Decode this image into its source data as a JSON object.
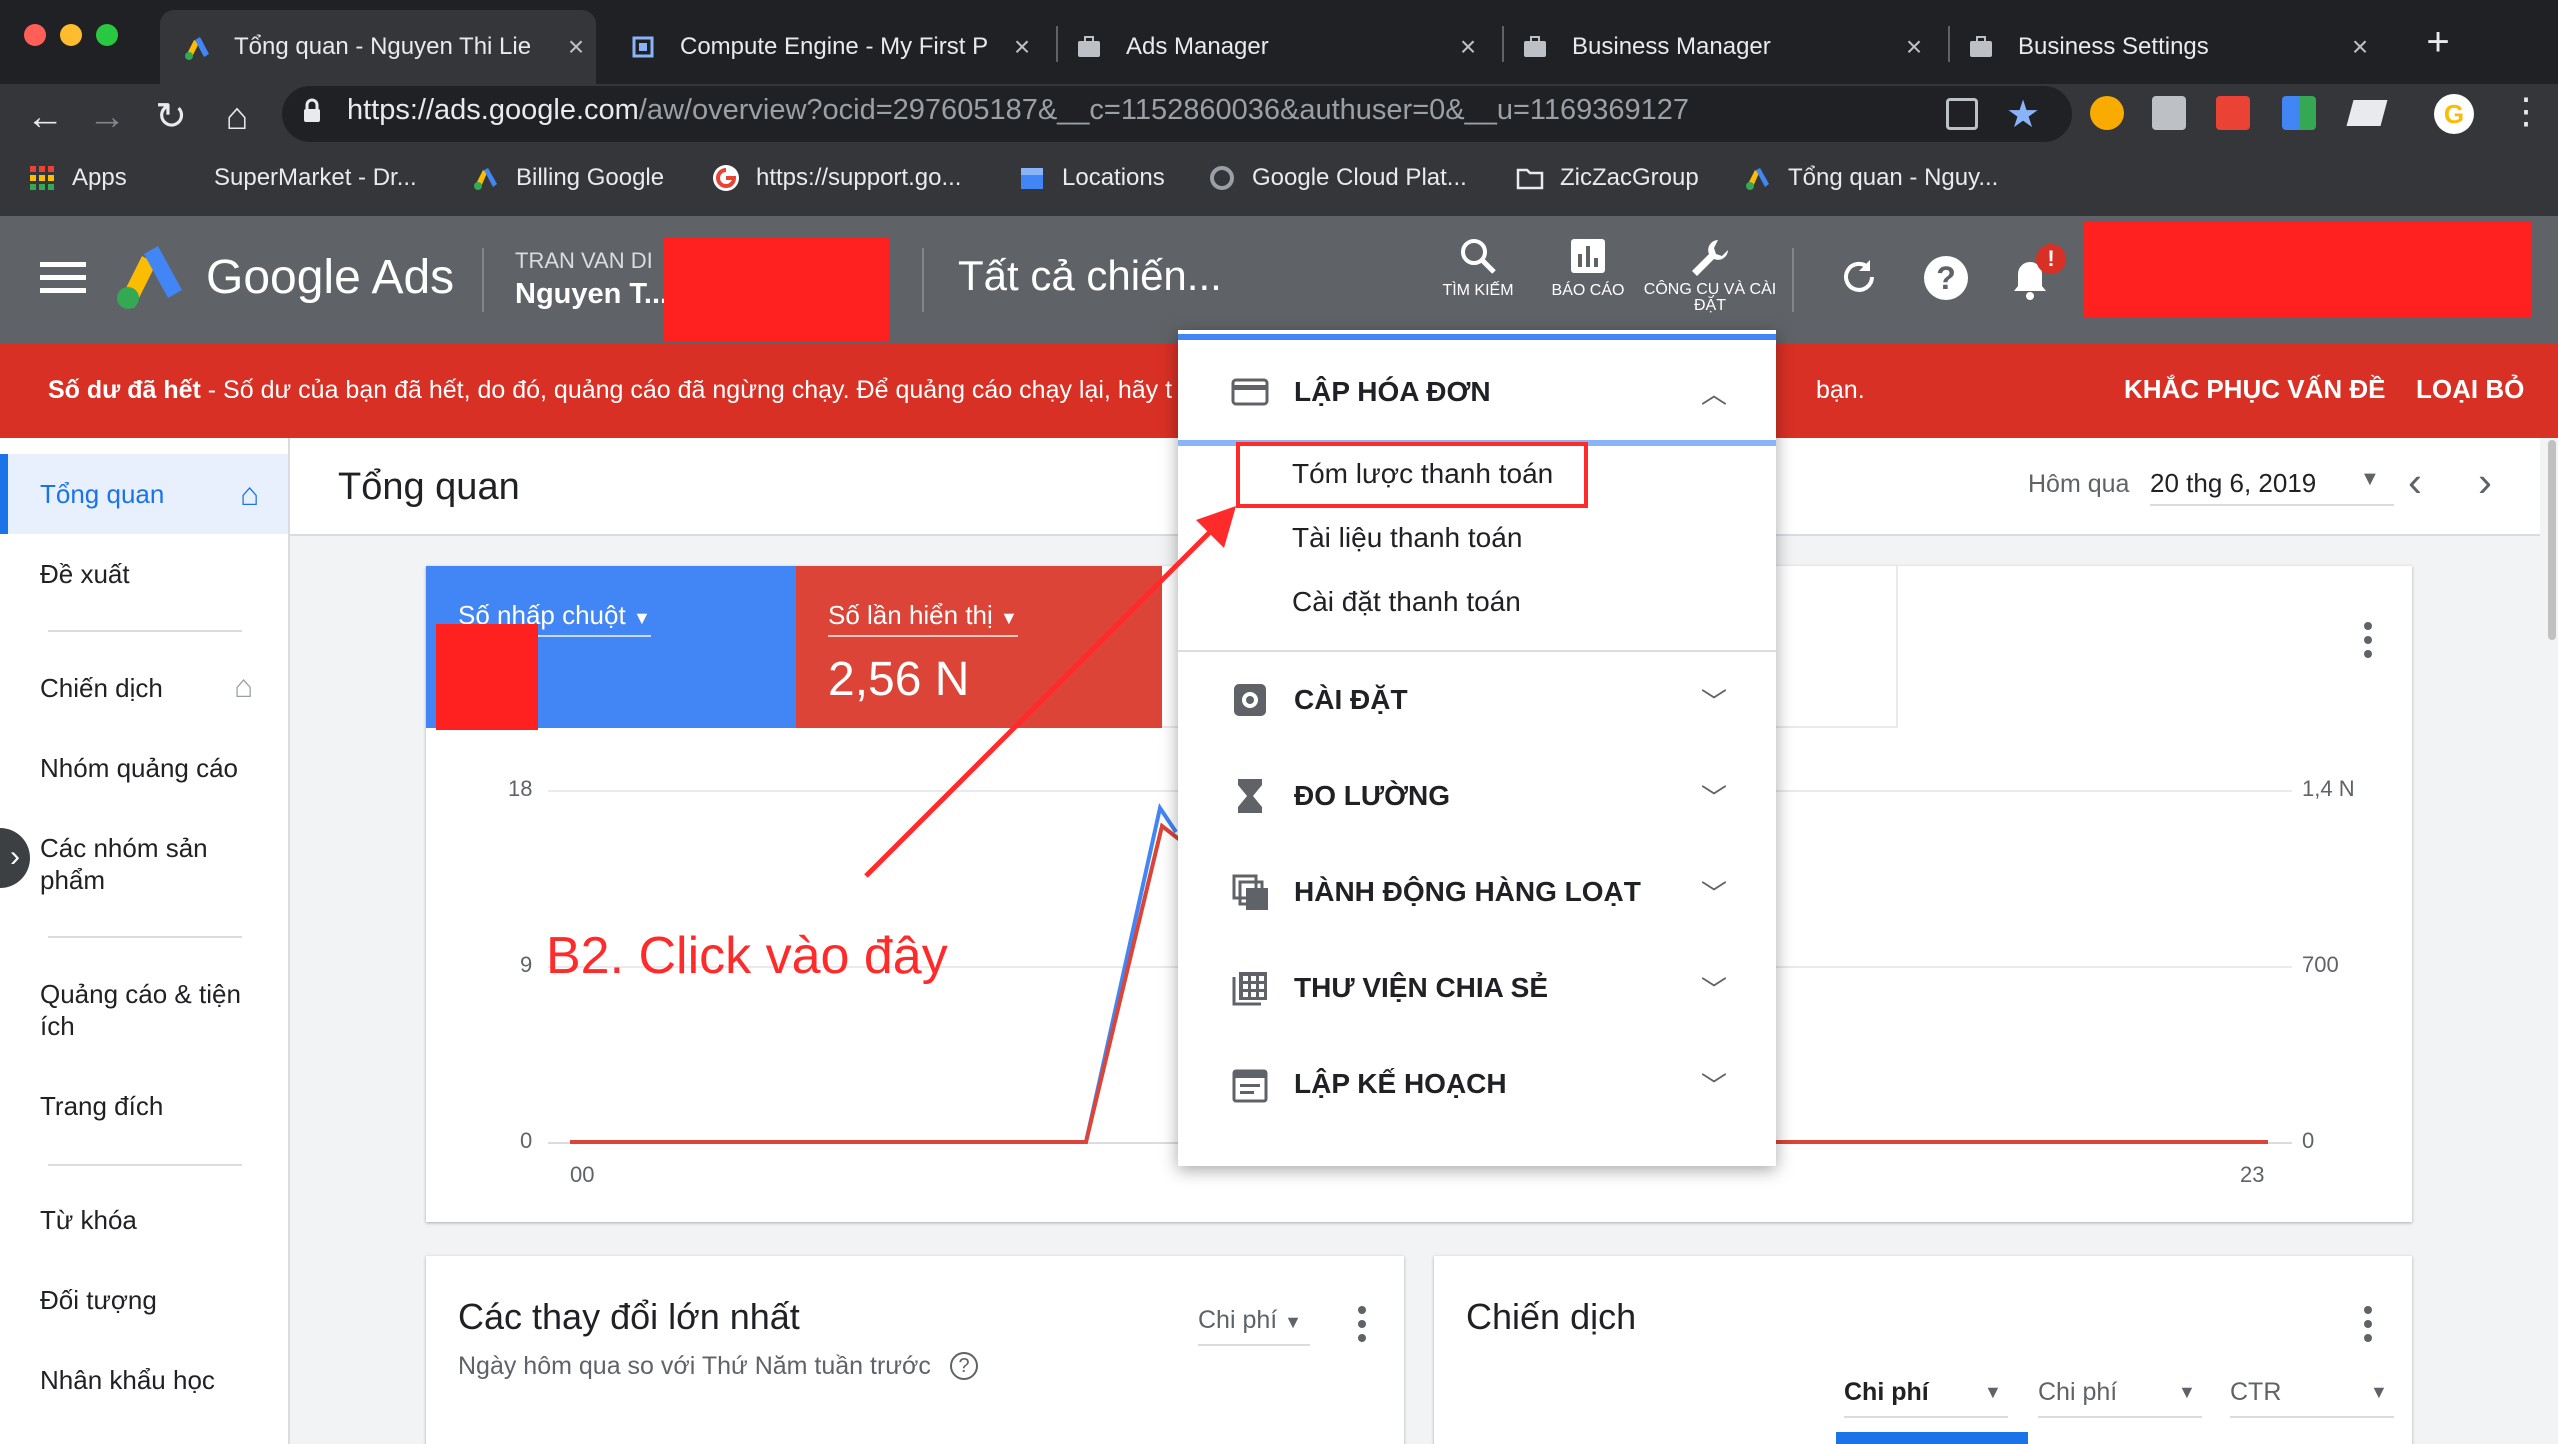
{
  "browser": {
    "tabs": [
      {
        "title": "Tổng quan - Nguyen Thi Lie",
        "active": true
      },
      {
        "title": "Compute Engine - My First P"
      },
      {
        "title": "Ads Manager"
      },
      {
        "title": "Business Manager"
      },
      {
        "title": "Business Settings"
      }
    ],
    "url_main": "https://ads.google.com",
    "url_rest": "/aw/overview?ocid=297605187&__c=1152860036&authuser=0&__u=1169369127",
    "bookmarks": [
      "Apps",
      "SuperMarket - Dr...",
      "Billing Google",
      "https://support.go...",
      "Locations",
      "Google Cloud Plat...",
      "ZicZacGroup",
      "Tổng quan - Nguy..."
    ]
  },
  "ads_header": {
    "product": "Google Ads",
    "account_line1": "TRAN VAN DI",
    "account_line2": "Nguyen T...",
    "campaign_selector": "Tất cả chiến...",
    "tools": [
      "TÌM KIẾM",
      "BÁO CÁO",
      "CÔNG CỤ VÀ CÀI ĐẶT"
    ],
    "notif_badge": "!"
  },
  "alert": {
    "bold": "Số dư đã hết",
    "text": " - Số dư của bạn đã hết, do đó, quảng cáo đã ngừng chạy. Để quảng cáo chạy lại, hãy t",
    "tail": "bạn.",
    "fix": "KHẮC PHỤC VẤN ĐỀ",
    "dismiss": "LOẠI BỎ"
  },
  "sidebar": {
    "items": [
      "Tổng quan",
      "Đề xuất",
      "Chiến dịch",
      "Nhóm quảng cáo",
      "Các nhóm sản phẩm",
      "Quảng cáo & tiện ích",
      "Trang đích",
      "Từ khóa",
      "Đối tượng",
      "Nhân khẩu học"
    ]
  },
  "page": {
    "title": "Tổng quan",
    "date_label": "Hôm qua",
    "date_value": "20 thg 6, 2019"
  },
  "metrics": [
    {
      "label": "Số nhấp chuột",
      "value": ""
    },
    {
      "label": "Số lần hiển thị",
      "value": "2,56 N"
    }
  ],
  "chart_data": {
    "type": "line",
    "x_start": "00",
    "x_end": "23",
    "y_left_ticks": [
      "18",
      "9",
      "0"
    ],
    "y_right_ticks": [
      "1,4 N",
      "700",
      "0"
    ],
    "series": [
      {
        "name": "Số nhấp chuột",
        "color": "#4285f4"
      },
      {
        "name": "Số lần hiển thị",
        "color": "#db4437"
      }
    ]
  },
  "changes_card": {
    "title": "Các thay đổi lớn nhất",
    "subtitle": "Ngày hôm qua so với Thứ Năm tuần trước",
    "metric": "Chi phí"
  },
  "campaign_card": {
    "title": "Chiến dịch",
    "cols": [
      "Chi phí",
      "Chi phí",
      "CTR"
    ]
  },
  "dropdown": {
    "billing": "LẬP HÓA ĐƠN",
    "billing_items": [
      "Tóm lược thanh toán",
      "Tài liệu thanh toán",
      "Cài đặt thanh toán"
    ],
    "sections": [
      "CÀI ĐẶT",
      "ĐO LƯỜNG",
      "HÀNH ĐỘNG HÀNG LOẠT",
      "THƯ VIỆN CHIA SẺ",
      "LẬP KẾ HOẠCH"
    ]
  },
  "annotation": "B2. Click vào đây",
  "colors": {
    "brand_blue": "#1a73e8",
    "alert_red": "#d93025",
    "annotation_red": "#ff2a2a"
  }
}
